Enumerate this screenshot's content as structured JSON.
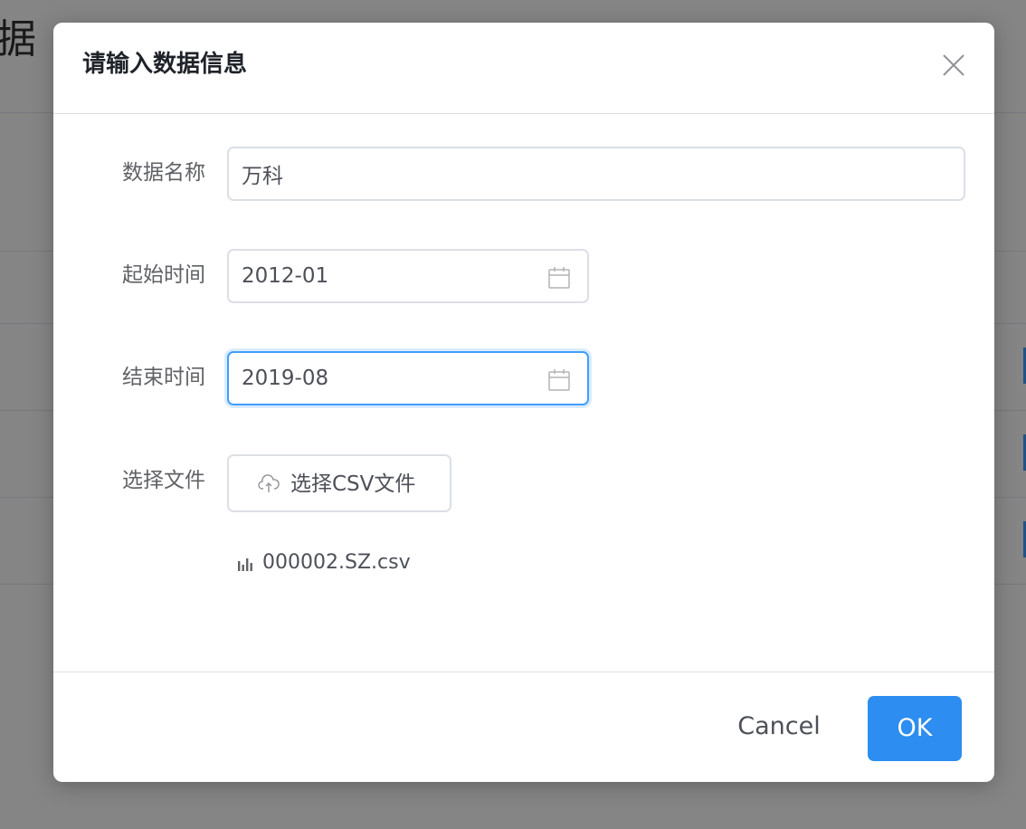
{
  "background": {
    "title_fragment": "据"
  },
  "dialog": {
    "title": "请输入数据信息",
    "close_icon": "close-icon",
    "fields": {
      "name": {
        "label": "数据名称",
        "value": "万科"
      },
      "start": {
        "label": "起始时间",
        "value": "2012-01",
        "icon": "calendar-icon"
      },
      "end": {
        "label": "结束时间",
        "value": "2019-08",
        "icon": "calendar-icon"
      },
      "file": {
        "label": "选择文件",
        "button_label": "选择CSV文件",
        "button_icon": "upload-cloud-icon",
        "selected_file": "000002.SZ.csv",
        "file_icon": "bar-chart-icon"
      }
    },
    "footer": {
      "cancel_label": "Cancel",
      "ok_label": "OK"
    }
  },
  "colors": {
    "primary": "#2d8df0",
    "focus_border": "#409eff",
    "overlay": "rgba(0,0,0,0.48)"
  }
}
